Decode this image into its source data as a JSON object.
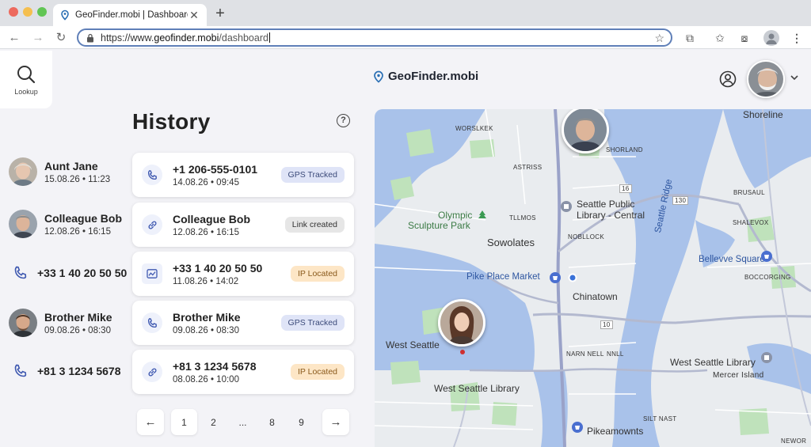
{
  "browser": {
    "tab_title": "GeoFinder.mobi | Dashboard",
    "url_prefix": "https://www.",
    "url_domain": "geofinder.mobi",
    "url_path": "/dashboard"
  },
  "app": {
    "lookup_label": "Lookup",
    "brand": "GeoFinder.mobi"
  },
  "history": {
    "title": "History",
    "help": "?",
    "recent": [
      {
        "name": "Aunt Jane",
        "date": "15.08.26 • 11:23"
      },
      {
        "name": "Colleague Bob",
        "date": "12.08.26 • 16:15"
      },
      {
        "number": "+33 1 40 20 50 50"
      },
      {
        "name": "Brother Mike",
        "date": "09.08.26 • 08:30"
      },
      {
        "number": "+81 3 1234 5678"
      }
    ],
    "cards": [
      {
        "title": "+1 206-555-0101",
        "date": "14.08.26 • 09:45",
        "badge": "GPS Tracked",
        "icon": "phone-icon"
      },
      {
        "title": "Colleague Bob",
        "date": "12.08.26 • 16:15",
        "badge": "Link created",
        "icon": "link-icon"
      },
      {
        "title": "+33 1 40 20 50 50",
        "date": "11.08.26 • 14:02",
        "badge": "IP Located",
        "icon": "ip-icon"
      },
      {
        "title": "Brother Mike",
        "date": "09.08.26 • 08:30",
        "badge": "GPS Tracked",
        "icon": "phone-icon"
      },
      {
        "title": "+81 3 1234 5678",
        "date": "08.08.26 • 10:00",
        "badge": "IP Located",
        "icon": "link-icon"
      }
    ],
    "pagination": {
      "prev": "←",
      "pages": [
        "1",
        "2",
        "...",
        "8",
        "9"
      ],
      "next": "→"
    }
  },
  "map": {
    "labels": {
      "shoreline": "Shoreline",
      "worslkek": "WORSLKEK",
      "shorland": "SHORLAND",
      "astriss": "ASTRISS",
      "r130": "130",
      "r16": "16",
      "brusaul": "BRUSAUL",
      "olympic1": "Olympic",
      "olympic2": "Sculpture Park",
      "tllmos": "TLLMOS",
      "spl1": "Seattle Public",
      "spl2": "Library - Central",
      "seattle_ridge": "Seattle Ridge",
      "shalevox": "SHALEVOX",
      "sowolates": "Sowolates",
      "noblock": "NOBLLOCK",
      "bellevue": "Bellevve Square",
      "boccorging": "BOCCORGING",
      "pike": "Pike Place Market",
      "chinatown": "Chinatown",
      "west_seattle": "West Seattle",
      "r10": "10",
      "narn_nell": "NARN NELL",
      "nnll": "NNLL",
      "west_seattle_library": "West Seattle Library",
      "mercer": "Mercer Island",
      "west_seattle_library2": "West Seattle Library",
      "silt_nast": "SILT NAST",
      "pikeamownts": "Pikeamownts",
      "newor": "NEWOR"
    }
  },
  "colors": {
    "accent": "#4a63c8",
    "gps_badge": "#dfe4f7",
    "ip_badge": "#fde6c6",
    "link_badge": "#e6e6e6",
    "water": "#a9c2ea",
    "land": "#e9ecef",
    "park": "#bfe2bb"
  }
}
